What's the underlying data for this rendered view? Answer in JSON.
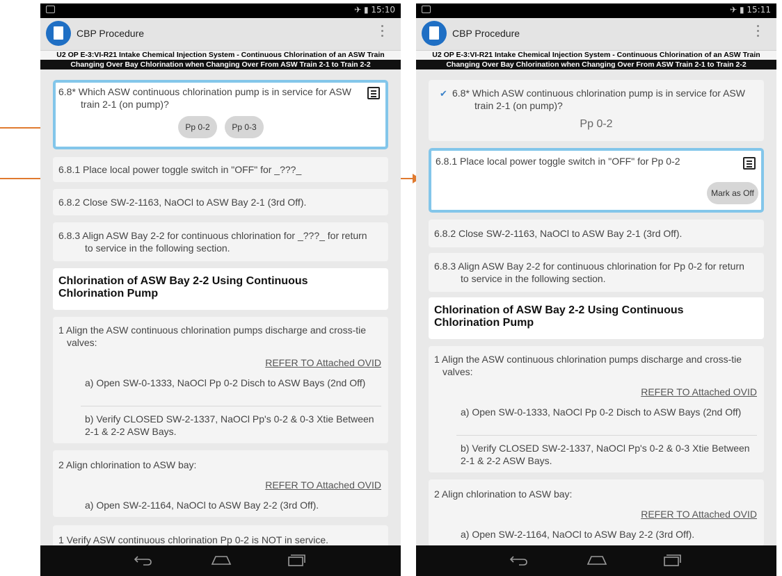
{
  "status_left": "",
  "status_right_left": "15:10",
  "status_right_right": "15:11",
  "app_title": "CBP Procedure",
  "procedure_title": "U2 OP E-3:VI-R21 Intake Chemical Injection System - Continuous Chlorination of an ASW Train",
  "procedure_subtitle": "Changing Over Bay Chlorination when Changing Over From ASW Train 2-1 to Train 2-2",
  "left": {
    "step_68": "6.8* Which ASW continuous chlorination pump is in service for ASW train 2-1 (on pump)?",
    "option_1": "Pp 0-2",
    "option_2": "Pp 0-3",
    "step_681": "6.8.1 Place local power toggle switch in \"OFF\" for _???_",
    "step_682": "6.8.2 Close SW-2-1163, NaOCl to ASW Bay 2-1 (3rd Off).",
    "step_683": "6.8.3 Align ASW Bay 2-2 for continuous chlorination for _???_ for return to service in the following section.",
    "section_heading": "Chlorination of ASW Bay 2-2 Using Continuous Chlorination Pump",
    "step_1": "1 Align the ASW continuous chlorination pumps discharge and cross-tie valves:",
    "refer_1": "REFER TO Attached OVID",
    "step_1a": "a) Open SW-0-1333, NaOCl Pp 0-2 Disch to ASW Bays (2nd Off)",
    "step_1b": "b) Verify CLOSED SW-2-1337, NaOCl Pp's 0-2 & 0-3 Xtie Between 2-1 & 2-2 ASW Bays.",
    "step_2": "2 Align chlorination to ASW bay:",
    "refer_2": "REFER TO Attached OVID",
    "step_2a": "a) Open SW-2-1164, NaOCl to ASW Bay 2-2 (3rd Off).",
    "step_verify": "1 Verify ASW continuous chlorination Pp 0-2 is NOT in service."
  },
  "right": {
    "step_68": "6.8* Which ASW continuous chlorination pump is in service for ASW train 2-1 (on pump)?",
    "answer": "Pp 0-2",
    "step_681": "6.8.1 Place local power toggle switch in \"OFF\" for Pp 0-2",
    "mark_off": "Mark as Off",
    "step_682": "6.8.2 Close SW-2-1163, NaOCl to ASW Bay 2-1 (3rd Off).",
    "step_683": "6.8.3 Align ASW Bay 2-2 for continuous chlorination for Pp 0-2 for return to service in the following section.",
    "section_heading": "Chlorination of ASW Bay 2-2 Using Continuous Chlorination Pump",
    "step_1": "1 Align the ASW continuous chlorination pumps discharge and cross-tie valves:",
    "refer_1": "REFER TO Attached OVID",
    "step_1a": "a) Open SW-0-1333, NaOCl Pp 0-2 Disch to ASW Bays (2nd Off)",
    "step_1b": "b) Verify CLOSED SW-2-1337, NaOCl Pp's 0-2 & 0-3 Xtie Between 2-1 & 2-2 ASW Bays.",
    "step_2": "2 Align chlorination to ASW bay:",
    "refer_2": "REFER TO Attached OVID",
    "step_2a": "a) Open SW-2-1164, NaOCl to ASW Bay 2-2 (3rd Off)."
  },
  "colors": {
    "active_border": "#83c6ea",
    "arrow": "#e07a2f",
    "app_icon": "#1f6fc4",
    "check": "#3b82c9"
  }
}
